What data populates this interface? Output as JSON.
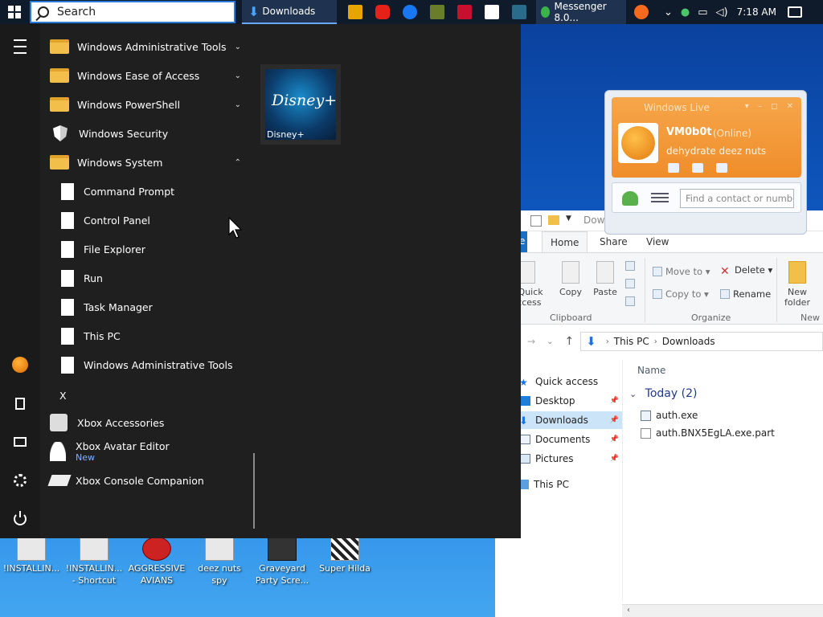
{
  "taskbar": {
    "search_placeholder": "Search",
    "active_app": "Downloads",
    "messenger_app": "Messenger 8.0...",
    "clock": "7:18 AM"
  },
  "start_menu": {
    "apps": [
      {
        "label": "Windows Administrative Tools",
        "kind": "folder",
        "chevron": "⌄"
      },
      {
        "label": "Windows Ease of Access",
        "kind": "folder",
        "chevron": "⌄"
      },
      {
        "label": "Windows PowerShell",
        "kind": "folder",
        "chevron": "⌄"
      },
      {
        "label": "Windows Security",
        "kind": "shield"
      },
      {
        "label": "Windows System",
        "kind": "folder",
        "chevron": "⌃"
      },
      {
        "label": "Command Prompt",
        "kind": "page"
      },
      {
        "label": "Control Panel",
        "kind": "page"
      },
      {
        "label": "File Explorer",
        "kind": "page"
      },
      {
        "label": "Run",
        "kind": "page"
      },
      {
        "label": "Task Manager",
        "kind": "page"
      },
      {
        "label": "This PC",
        "kind": "page"
      },
      {
        "label": "Windows Administrative Tools",
        "kind": "page"
      }
    ],
    "letter_x": "X",
    "xbox_accessories": "Xbox Accessories",
    "xbox_avatar_editor": "Xbox Avatar Editor",
    "xbox_avatar_badge": "New",
    "xbox_console_companion": "Xbox Console Companion",
    "tile": {
      "logo": "Disney+",
      "label": "Disney+"
    }
  },
  "messenger": {
    "title": "Windows Live",
    "name": "VM0b0t",
    "status": "(Online)",
    "personal_message": "dehydrate deez nuts",
    "search_placeholder": "Find a contact or number"
  },
  "explorer": {
    "title": "Downloads",
    "tabs": {
      "file": "e",
      "home": "Home",
      "share": "Share",
      "view": "View"
    },
    "ribbon": {
      "pin": "o Quick\naccess",
      "copy": "Copy",
      "paste": "Paste",
      "move_to": "Move to",
      "copy_to": "Copy to",
      "delete": "Delete",
      "rename": "Rename",
      "new_folder": "New\nfolder",
      "group_clipboard": "Clipboard",
      "group_organize": "Organize",
      "group_new": "New"
    },
    "address": {
      "root": "This PC",
      "folder": "Downloads"
    },
    "nav": {
      "quick_access": "Quick access",
      "desktop": "Desktop",
      "downloads": "Downloads",
      "documents": "Documents",
      "pictures": "Pictures",
      "this_pc": "This PC"
    },
    "column_name": "Name",
    "group_label": "Today (2)",
    "files": [
      "auth.exe",
      "auth.BNX5EgLA.exe.part"
    ]
  },
  "desktop": {
    "icons": [
      "!INSTALLIN...",
      "!INSTALLIN...\n- Shortcut",
      "AGGRESSIVE\nAVIANS",
      "deez nuts spy",
      "Graveyard\nParty Scre...",
      "Super Hilda"
    ]
  }
}
